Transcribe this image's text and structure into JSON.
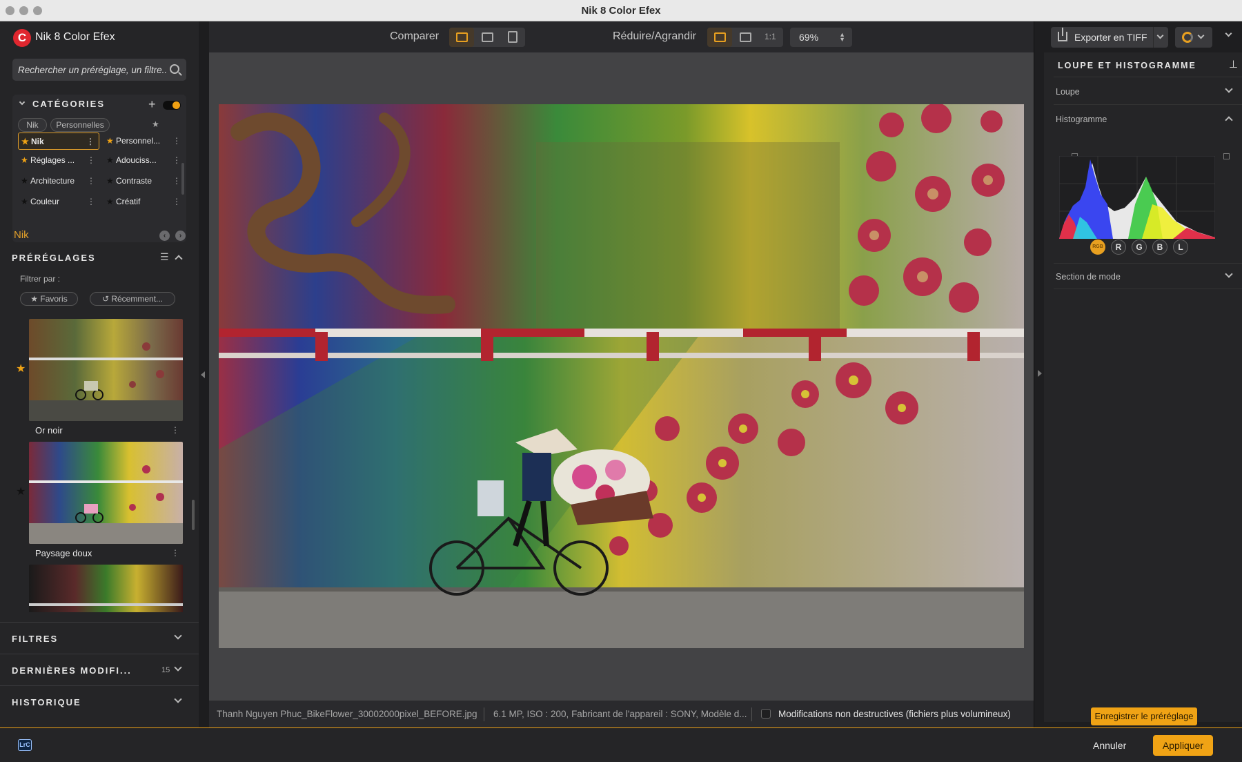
{
  "window": {
    "title": "Nik 8 Color Efex"
  },
  "app": {
    "name": "Nik 8 Color Efex",
    "logo_letter": "C"
  },
  "search": {
    "placeholder": "Rechercher un préréglage, un filtre..."
  },
  "categories": {
    "title": "CATÉGORIES",
    "tabs": [
      "Nik",
      "Personnelles"
    ],
    "items": [
      {
        "label": "Nik",
        "starred": true,
        "selected": true
      },
      {
        "label": "Personnel...",
        "starred": true,
        "selected": false
      },
      {
        "label": "Réglages ...",
        "starred": true,
        "selected": false
      },
      {
        "label": "Adouciss...",
        "starred": false,
        "selected": false
      },
      {
        "label": "Architecture",
        "starred": false,
        "selected": false
      },
      {
        "label": "Contraste",
        "starred": false,
        "selected": false
      },
      {
        "label": "Couleur",
        "starred": false,
        "selected": false
      },
      {
        "label": "Créatif",
        "starred": false,
        "selected": false
      }
    ]
  },
  "collection": {
    "label": "Nik"
  },
  "presets": {
    "title": "PRÉRÉGLAGES",
    "filter_label": "Filtrer par :",
    "filter_favorites": "Favoris",
    "filter_recent": "Récemment...",
    "items": [
      {
        "name": "Or noir",
        "favorite": true
      },
      {
        "name": "Paysage doux",
        "favorite": false
      }
    ]
  },
  "sections": {
    "filters": "FILTRES",
    "recent": "DERNIÈRES MODIFI...",
    "recent_count": "15",
    "history": "HISTORIQUE"
  },
  "toolbar": {
    "compare_label": "Comparer",
    "zoom_label": "Réduire/Agrandir",
    "one_to_one": "1:1",
    "zoom_value": "69%"
  },
  "status": {
    "filename": "Thanh Nguyen Phuc_BikeFlower_30002000pixel_BEFORE.jpg",
    "meta": "6.1 MP, ISO : 200, Fabricant de l'appareil : SONY, Modèle d...",
    "nondestructive": "Modifications non destructives (fichiers plus volumineux)"
  },
  "right_panel": {
    "export_label": "Exporter en TIFF",
    "loupe_title": "LOUPE ET HISTOGRAMME",
    "loupe": "Loupe",
    "histogram": "Histogramme",
    "channels": [
      "RGB",
      "R",
      "G",
      "B",
      "L"
    ],
    "mode_section": "Section de mode",
    "save_preset": "Enregistrer le préréglage"
  },
  "bottom": {
    "lrc": "LrC",
    "cancel": "Annuler",
    "apply": "Appliquer"
  },
  "colors": {
    "accent": "#f0a315",
    "logo": "#e0272f"
  }
}
